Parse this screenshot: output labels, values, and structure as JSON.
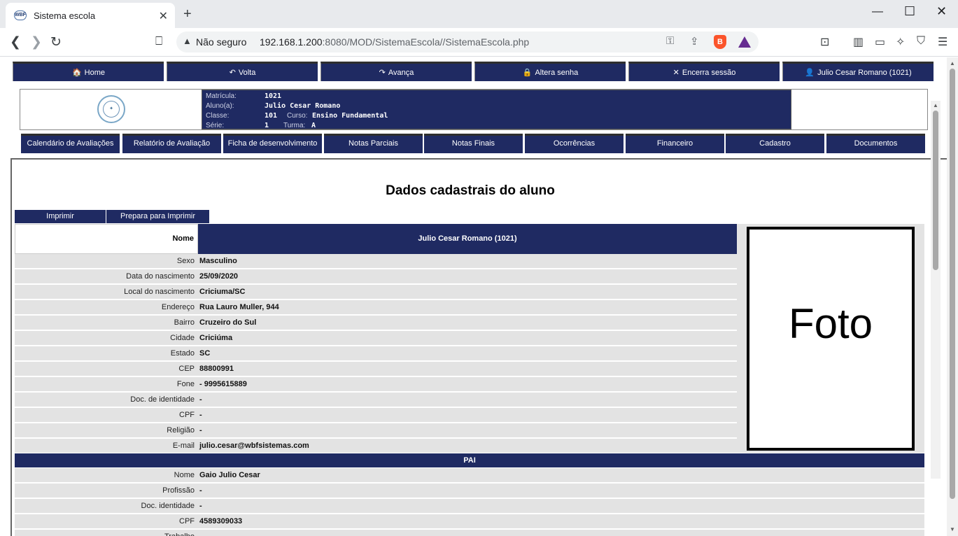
{
  "browser": {
    "tab_title": "Sistema escola",
    "favicon_text": "WBF",
    "security_label": "Não seguro",
    "url_host": "192.168.1.200",
    "url_rest": ":8080/MOD/SistemaEscola//SistemaEscola.php"
  },
  "topnav": [
    {
      "label": "Home",
      "icon": "home-icon"
    },
    {
      "label": "Volta",
      "icon": "undo-icon"
    },
    {
      "label": "Avança",
      "icon": "redo-icon"
    },
    {
      "label": "Altera senha",
      "icon": "lock-icon"
    },
    {
      "label": "Encerra sessão",
      "icon": "x-icon"
    },
    {
      "label": "Julio Cesar Romano (1021)",
      "icon": "user-icon"
    }
  ],
  "info": {
    "matricula_label": "Matrícula:",
    "matricula": "1021",
    "aluno_label": "Aluno(a):",
    "aluno": "Julio Cesar Romano",
    "classe_label": "Classe:",
    "classe": "101",
    "curso_label": "Curso:",
    "curso": "Ensino Fundamental",
    "serie_label": "Série:",
    "serie": "1",
    "turma_label": "Turma:",
    "turma": "A"
  },
  "subnav": [
    "Calendário de Avaliações",
    "Relatório de Avaliação",
    "Ficha de desenvolvimento",
    "Notas Parciais",
    "Notas Finais",
    "Ocorrências",
    "Financeiro",
    "Cadastro",
    "Documentos"
  ],
  "page": {
    "heading": "Dados cadastrais do aluno",
    "print_button": "Imprimir",
    "prepare_print_button": "Prepara para Imprimir",
    "name_label": "Nome",
    "name_value": "Julio Cesar Romano (1021)",
    "photo_text": "Foto"
  },
  "student_fields": [
    {
      "label": "Sexo",
      "value": "Masculino"
    },
    {
      "label": "Data do nascimento",
      "value": "25/09/2020"
    },
    {
      "label": "Local do nascimento",
      "value": "Criciuma/SC"
    },
    {
      "label": "Endereço",
      "value": "Rua Lauro Muller, 944"
    },
    {
      "label": "Bairro",
      "value": "Cruzeiro do Sul"
    },
    {
      "label": "Cidade",
      "value": "Criciúma"
    },
    {
      "label": "Estado",
      "value": "SC"
    },
    {
      "label": "CEP",
      "value": "88800991"
    },
    {
      "label": "Fone",
      "value": "- 9995615889"
    },
    {
      "label": "Doc. de identidade",
      "value": "-"
    },
    {
      "label": "CPF",
      "value": "-"
    },
    {
      "label": "Religião",
      "value": "-"
    },
    {
      "label": "E-mail",
      "value": "julio.cesar@wbfsistemas.com"
    }
  ],
  "father_header": "PAI",
  "father_fields": [
    {
      "label": "Nome",
      "value": "Gaio Julio Cesar"
    },
    {
      "label": "Profissão",
      "value": "-"
    },
    {
      "label": "Doc. identidade",
      "value": "-"
    },
    {
      "label": "CPF",
      "value": "4589309033"
    },
    {
      "label": "Trabalho",
      "value": "-"
    }
  ],
  "colors": {
    "nav_blue": "#1f2a62",
    "row_gray": "#e3e3e3"
  }
}
